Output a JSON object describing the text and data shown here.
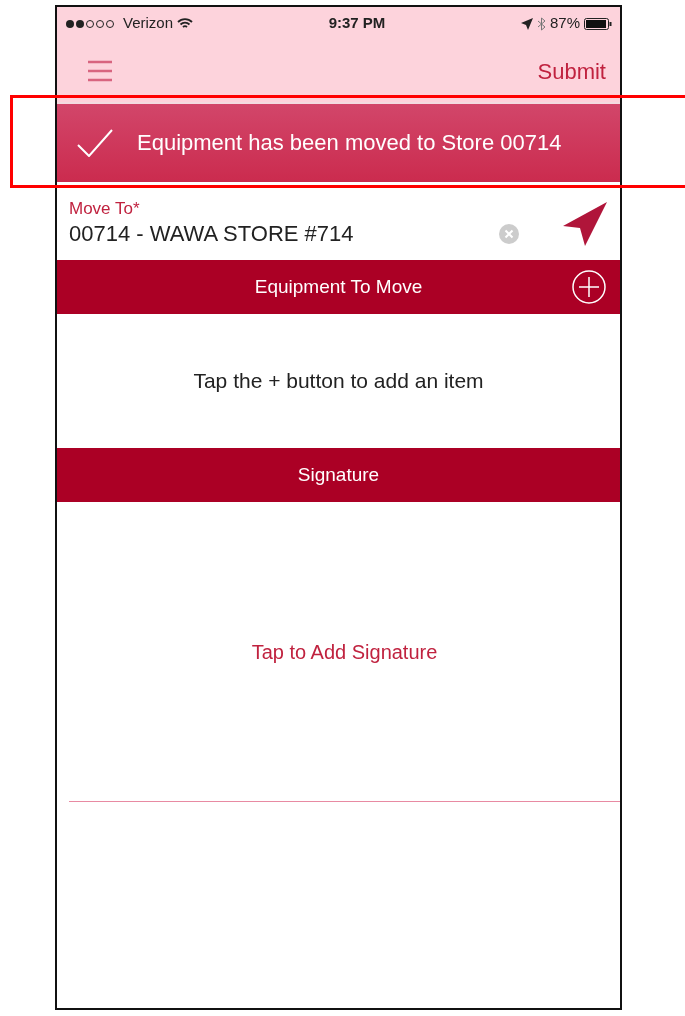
{
  "status_bar": {
    "carrier": "Verizon",
    "time": "9:37 PM",
    "battery": "87%"
  },
  "nav": {
    "action": "Submit"
  },
  "notice": {
    "text": "Equipment has been moved to Store 00714"
  },
  "move_to": {
    "label": "Move To*",
    "value": "00714 - WAWA STORE #714"
  },
  "equipment": {
    "title": "Equipment To Move",
    "empty_text": "Tap the + button to add an item"
  },
  "signature": {
    "title": "Signature",
    "prompt": "Tap to Add Signature"
  }
}
